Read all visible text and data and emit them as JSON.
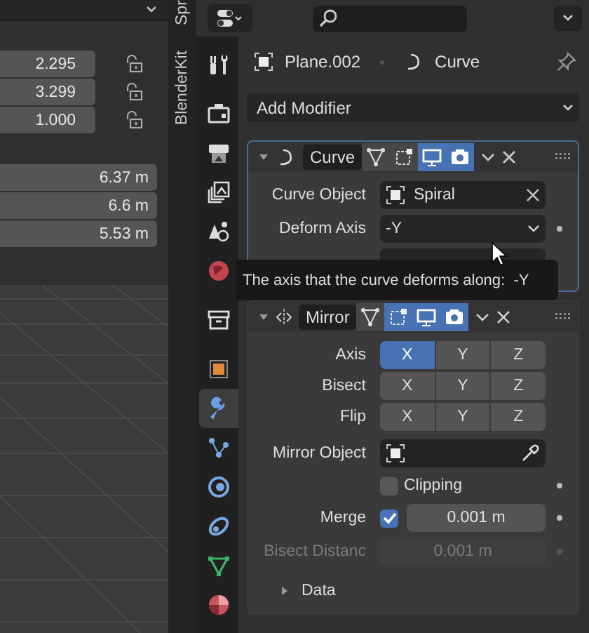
{
  "viewport": {
    "transform_fields": [
      {
        "value": "2.295",
        "locked": false
      },
      {
        "value": "3.299",
        "locked": false
      },
      {
        "value": "1.000",
        "locked": false
      }
    ],
    "dimension_fields": [
      "6.37 m",
      "6.6 m",
      "5.53 m"
    ]
  },
  "side_tabs": [
    {
      "label": "Spr"
    },
    {
      "label": "BlenderKit"
    }
  ],
  "properties": {
    "breadcrumb": {
      "object": "Plane.002",
      "data": "Curve"
    },
    "tabs": [
      {
        "kind": "tool",
        "selected": false
      },
      {
        "kind": "render",
        "selected": false
      },
      {
        "kind": "output",
        "selected": false
      },
      {
        "kind": "view_layer",
        "selected": false
      },
      {
        "kind": "scene",
        "selected": false
      },
      {
        "kind": "world",
        "selected": false
      },
      {
        "kind": "collection",
        "selected": false
      },
      {
        "kind": "object",
        "selected": false
      },
      {
        "kind": "modifiers",
        "selected": true
      },
      {
        "kind": "particles",
        "selected": false
      },
      {
        "kind": "physics",
        "selected": false
      },
      {
        "kind": "constraints",
        "selected": false
      },
      {
        "kind": "data",
        "selected": false
      },
      {
        "kind": "material",
        "selected": false
      }
    ],
    "add_modifier": "Add Modifier",
    "modifiers": [
      {
        "kind": "curve",
        "name": "Curve",
        "expanded": true,
        "toggles": [
          {
            "kind": "edit_mode",
            "on": false
          },
          {
            "kind": "cage",
            "on": false
          },
          {
            "kind": "viewport",
            "on": true
          },
          {
            "kind": "render",
            "on": true
          }
        ],
        "curve_object": {
          "label": "Curve Object",
          "value": "Spiral"
        },
        "deform_axis": {
          "label": "Deform Axis",
          "value": "-Y"
        }
      },
      {
        "kind": "mirror",
        "name": "Mirror",
        "expanded": true,
        "toggles": [
          {
            "kind": "edit_mode",
            "on": false
          },
          {
            "kind": "cage",
            "on": true
          },
          {
            "kind": "viewport",
            "on": true
          },
          {
            "kind": "render",
            "on": true
          }
        ],
        "axis_rows": [
          {
            "label": "Axis",
            "options": [
              {
                "label": "X",
                "selected": true
              },
              {
                "label": "Y",
                "selected": false
              },
              {
                "label": "Z",
                "selected": false
              }
            ]
          },
          {
            "label": "Bisect",
            "options": [
              {
                "label": "X",
                "selected": false
              },
              {
                "label": "Y",
                "selected": false
              },
              {
                "label": "Z",
                "selected": false
              }
            ]
          },
          {
            "label": "Flip",
            "options": [
              {
                "label": "X",
                "selected": false
              },
              {
                "label": "Y",
                "selected": false
              },
              {
                "label": "Z",
                "selected": false
              }
            ]
          }
        ],
        "mirror_object": {
          "label": "Mirror Object"
        },
        "clipping": {
          "label": "Clipping",
          "checked": false
        },
        "merge": {
          "label": "Merge",
          "checked": true,
          "value": "0.001 m"
        },
        "bisect_distance": {
          "label": "Bisect Distanc",
          "value": "0.001 m",
          "disabled": true
        },
        "subpanel": {
          "label": "Data",
          "expanded": false
        }
      }
    ]
  },
  "tooltip": {
    "text": "The axis that the curve deforms along:  -Y"
  }
}
